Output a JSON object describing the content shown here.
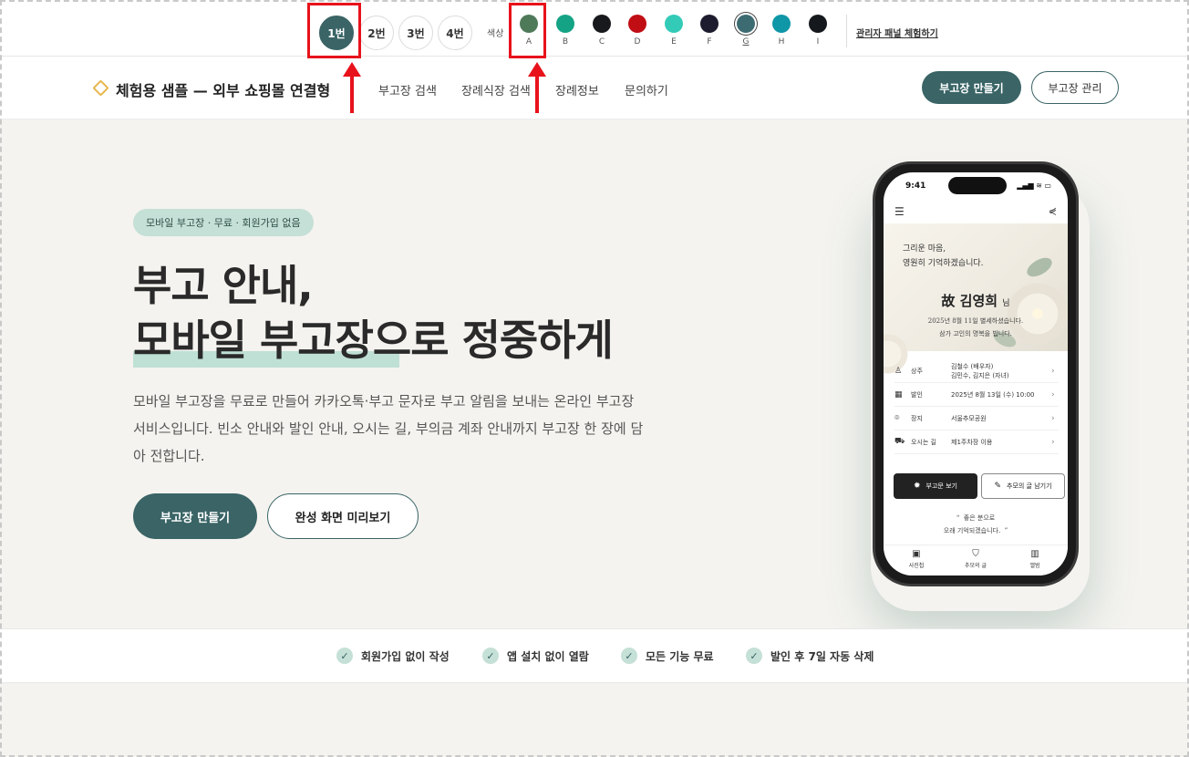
{
  "toolbar": {
    "versions": [
      {
        "label": "1번",
        "active": true
      },
      {
        "label": "2번",
        "active": false
      },
      {
        "label": "3번",
        "active": false
      },
      {
        "label": "4번",
        "active": false
      }
    ],
    "color_label": "색상",
    "swatches": [
      {
        "label": "A",
        "color": "#4f7a5a"
      },
      {
        "label": "B",
        "color": "#14a385"
      },
      {
        "label": "C",
        "color": "#17191c"
      },
      {
        "label": "D",
        "color": "#c00e14"
      },
      {
        "label": "E",
        "color": "#33cbb8"
      },
      {
        "label": "F",
        "color": "#1c1c2e"
      },
      {
        "label": "G",
        "color": "#3d6b72",
        "selected": true
      },
      {
        "label": "H",
        "color": "#0f96a7"
      },
      {
        "label": "I",
        "color": "#15181c"
      }
    ],
    "admin_link": "관리자 패널 체험하기"
  },
  "header": {
    "logo_text": "체험용 샘플 — 외부 쇼핑몰 연결형",
    "nav": [
      "부고장 검색",
      "장례식장 검색",
      "장례정보",
      "문의하기"
    ],
    "primary_button": "부고장 만들기",
    "secondary_button": "부고장 관리"
  },
  "hero": {
    "badge": "모바일 부고장 · 무료 · 회원가입 없음",
    "title_line1": "부고 안내,",
    "title_line2": "모바일 부고장으로 정중하게",
    "description": "모바일 부고장을 무료로 만들어 카카오톡·부고 문자로 부고 알림을 보내는 온라인 부고장 서비스입니다. 빈소 안내와 발인 안내, 오시는 길, 부의금 계좌 안내까지 부고장 한 장에 담아 전합니다.",
    "primary_button": "부고장 만들기",
    "secondary_button": "완성 화면 미리보기"
  },
  "phone": {
    "time": "9:41",
    "status_icons": "▂▄▆ ≋ ▭",
    "quote": "그리운 마음,\n영원히 기억하겠습니다.",
    "name_prefix": "故",
    "name": "김영희",
    "name_suffix": "님",
    "sub1": "2025년 8월 11일 별세하셨습니다.",
    "sub2": "삼가 고인의 명복을 빕니다.",
    "rows": [
      {
        "icon": "person-icon",
        "glyph": "♙",
        "key": "상주",
        "value": "김철수 (배우자)\n김민수, 김지은 (자녀)"
      },
      {
        "icon": "calendar-icon",
        "glyph": "▦",
        "key": "발인",
        "value": "2025년 8월 13일 (수) 10:00"
      },
      {
        "icon": "location-icon",
        "glyph": "⌾",
        "key": "장지",
        "value": "서울추모공원"
      },
      {
        "icon": "car-icon",
        "glyph": "⛟",
        "key": "오시는 길",
        "value": "제1주차장 이용"
      }
    ],
    "btn_view": "부고문 보기",
    "btn_write": "추모의 글 남기기",
    "quote2_line1": "좋은 분으로",
    "quote2_line2": "오래 기억되겠습니다.",
    "tabs": [
      {
        "icon": "photo-icon",
        "glyph": "▣",
        "label": "사진첩"
      },
      {
        "icon": "memorial-icon",
        "glyph": "⛉",
        "label": "추모의 글"
      },
      {
        "icon": "book-icon",
        "glyph": "▥",
        "label": "앨범"
      }
    ]
  },
  "features": [
    "회원가입 없이 작성",
    "앱 설치 없이 열람",
    "모든 기능 무료",
    "발인 후 7일 자동 삭제"
  ]
}
